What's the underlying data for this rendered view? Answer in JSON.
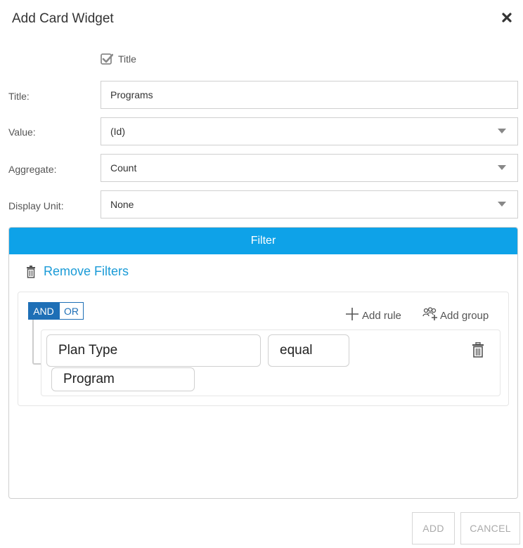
{
  "dialog": {
    "title": "Add Card Widget",
    "close_icon": "close-x-icon"
  },
  "title_toggle": {
    "label": "Title",
    "checked": true
  },
  "form": {
    "title": {
      "label": "Title:",
      "value": "Programs"
    },
    "value": {
      "label": "Value:",
      "value": "(Id)"
    },
    "aggregate": {
      "label": "Aggregate:",
      "value": "Count"
    },
    "display_unit": {
      "label": "Display Unit:",
      "value": "None"
    }
  },
  "filter": {
    "header": "Filter",
    "remove_filters": "Remove Filters",
    "conjunctions": {
      "and": "AND",
      "or": "OR",
      "active": "AND"
    },
    "add_rule": "Add rule",
    "add_group": "Add group",
    "rule": {
      "field": "Plan Type",
      "operator": "equal",
      "value": "Program"
    }
  },
  "footer": {
    "add": "ADD",
    "cancel": "CANCEL"
  },
  "colors": {
    "accent": "#0ea2e8",
    "conjunction_active": "#1e6fb6",
    "link": "#1a9bd7"
  }
}
